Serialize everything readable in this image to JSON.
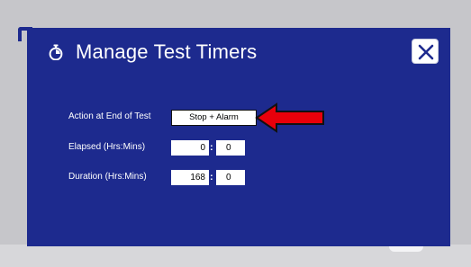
{
  "dialog": {
    "title": "Manage Test Timers",
    "title_icon": "stopwatch-icon",
    "close_icon": "close-icon"
  },
  "fields": {
    "action": {
      "label": "Action at End of Test",
      "value": "Stop + Alarm"
    },
    "elapsed": {
      "label": "Elapsed (Hrs:Mins)",
      "hours": "0",
      "mins": "0"
    },
    "duration": {
      "label": "Duration (Hrs:Mins)",
      "hours": "168",
      "mins": "0"
    }
  },
  "colors": {
    "dialog_bg": "#1d2a8e",
    "arrow": "#e8000b",
    "text": "#ffffff"
  },
  "annotation": {
    "arrow_icon": "red-arrow-icon"
  }
}
